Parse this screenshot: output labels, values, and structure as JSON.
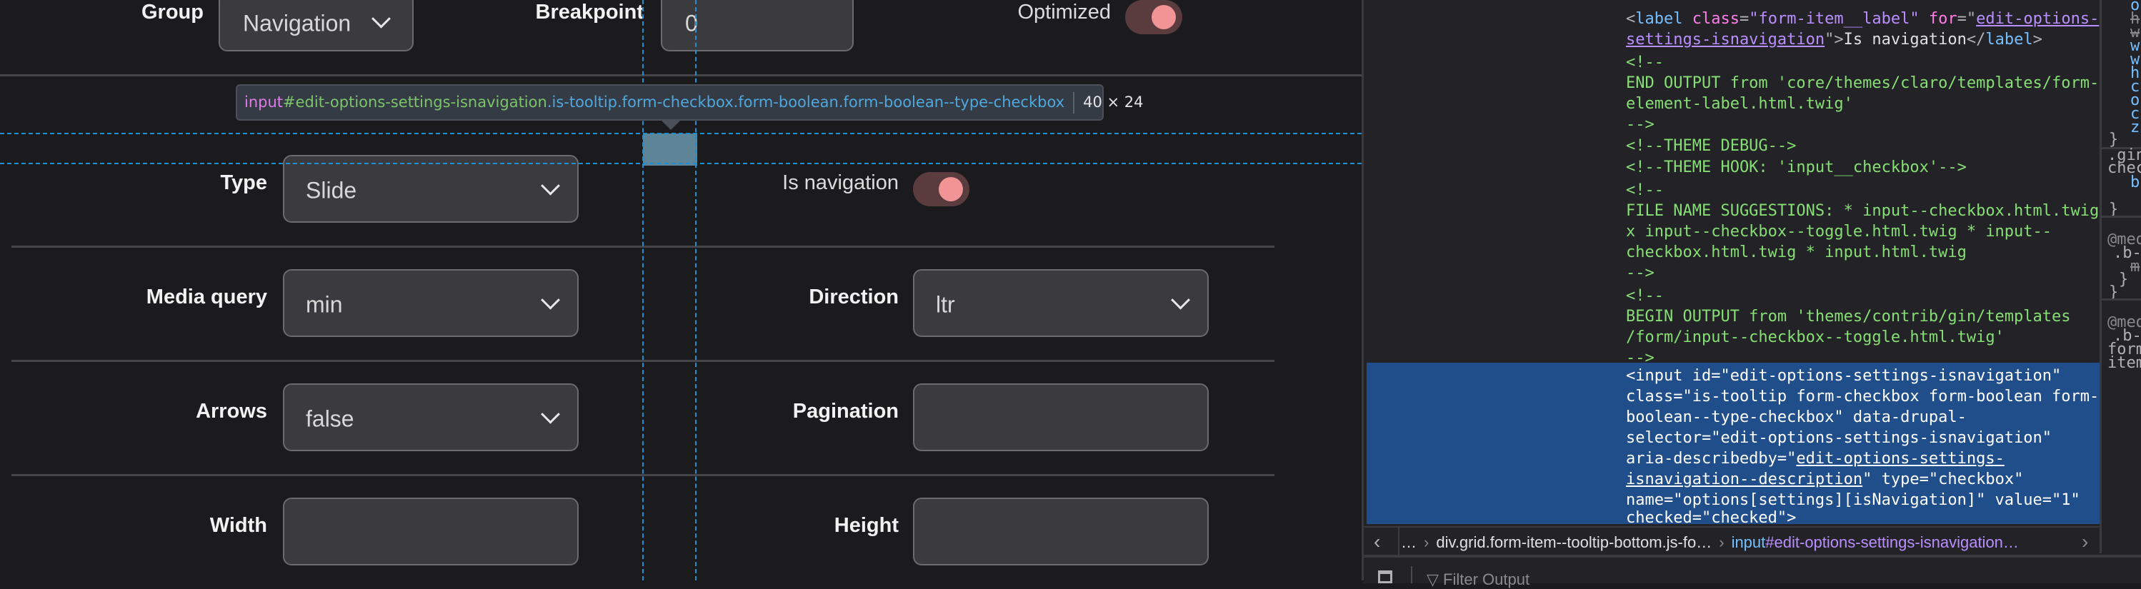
{
  "form": {
    "rows": [
      {
        "left": {
          "label": "Group",
          "type": "select",
          "value": "Navigation"
        },
        "middle": {
          "label": "Breakpoint",
          "type": "input",
          "value": "0"
        },
        "right": {
          "label": "Optimized",
          "type": "toggle",
          "checked": true
        }
      },
      {
        "left": {
          "label": "Type",
          "type": "select",
          "value": "Slide"
        },
        "right": {
          "label": "Is navigation",
          "type": "toggle",
          "checked": true
        }
      },
      {
        "left": {
          "label": "Media query",
          "type": "select",
          "value": "min"
        },
        "right": {
          "label": "Direction",
          "type": "select",
          "value": "ltr"
        }
      },
      {
        "left": {
          "label": "Arrows",
          "type": "select",
          "value": "false"
        },
        "right": {
          "label": "Pagination",
          "type": "input",
          "value": ""
        }
      },
      {
        "left": {
          "label": "Width",
          "type": "input",
          "value": ""
        },
        "right": {
          "label": "Height",
          "type": "input",
          "value": ""
        }
      }
    ]
  },
  "inspector_tooltip": {
    "tag": "input",
    "id": "#edit-options-settings-isnavigation",
    "classes": ".is-tooltip.form-checkbox.form-boolean.form-boolean--type-checkbox",
    "dimensions": "40 × 24"
  },
  "devtools": {
    "markup": {
      "label_line1_open": "<",
      "label_tag": "label",
      "label_attr_class": "class",
      "label_class_value": "\"form-item__label\"",
      "label_attr_for": "for",
      "label_for_value_1": "edit-options-",
      "label_for_value_2": "settings-isnavigation",
      "label_text": "Is navigation",
      "comments": [
        "<!--",
        "END OUTPUT from 'core/themes/claro/templates/form-",
        "element-label.html.twig'",
        "-->",
        "<!--THEME DEBUG-->",
        "<!--THEME HOOK: 'input__checkbox'-->",
        "<!--",
        "FILE NAME SUGGESTIONS: * input--checkbox.html.twig",
        "x input--checkbox--toggle.html.twig * input--",
        "checkbox.html.twig * input.html.twig",
        "-->",
        "<!--",
        "BEGIN OUTPUT from 'themes/contrib/gin/templates",
        "/form/input--checkbox--toggle.html.twig'",
        "-->"
      ],
      "selected_lines": [
        "<input id=\"edit-options-settings-isnavigation\"",
        "class=\"is-tooltip form-checkbox form-boolean form-",
        "boolean--type-checkbox\" data-drupal-",
        "selector=\"edit-options-settings-isnavigation\""
      ],
      "selected_aria_prefix": "aria-describedby=\"",
      "selected_aria_link_1": "edit-options-settings-",
      "selected_aria_link_2": "isnavigation--description",
      "selected_aria_suffix": "\" type=\"checkbox\"",
      "selected_name_line": "name=\"options[settings][isNavigation]\" value=\"1\"",
      "selected_checked_line": "checked=\"checked\">"
    },
    "rules_fragments": {
      "prop_lines": [
        "o",
        "h",
        "w",
        "w",
        "w",
        "h",
        "c",
        "o",
        "c",
        "z"
      ],
      "brace": "}",
      "gin_sel_1": ".gin",
      "gin_sel_2": "chec",
      "gin_prop": "b",
      "media_1": "@med",
      "media_1_sel": ".b-",
      "media_1_prop": "m",
      "media_2": "@med",
      "media_2_sel": ".b-",
      "media_2_line3": "form",
      "media_2_line4": "item"
    },
    "breadcrumbs": {
      "ellipsis": "…",
      "items": [
        "div.grid.form-item--tooltip-bottom.js-fo…"
      ],
      "current_tag": "input",
      "current_rest": "#edit-options-settings-isnavigation…"
    },
    "console": {
      "filter_placeholder": "Filter Output"
    }
  }
}
